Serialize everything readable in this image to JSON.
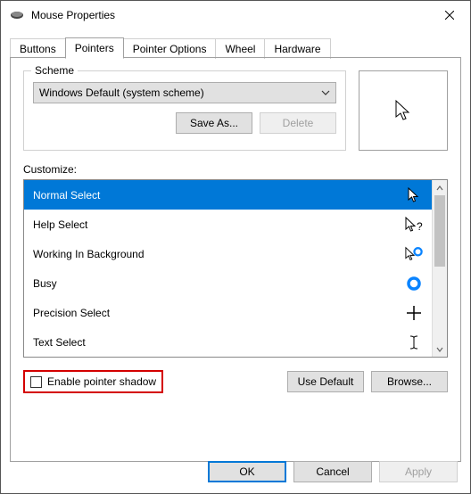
{
  "window": {
    "title": "Mouse Properties"
  },
  "tabs": {
    "items": [
      {
        "label": "Buttons"
      },
      {
        "label": "Pointers"
      },
      {
        "label": "Pointer Options"
      },
      {
        "label": "Wheel"
      },
      {
        "label": "Hardware"
      }
    ],
    "active": 1
  },
  "scheme": {
    "legend": "Scheme",
    "selected": "Windows Default (system scheme)",
    "save_as": "Save As...",
    "delete": "Delete"
  },
  "customize": {
    "label": "Customize:",
    "rows": [
      {
        "label": "Normal Select",
        "icon": "cursor-arrow",
        "selected": true
      },
      {
        "label": "Help Select",
        "icon": "cursor-help"
      },
      {
        "label": "Working In Background",
        "icon": "cursor-working"
      },
      {
        "label": "Busy",
        "icon": "cursor-busy"
      },
      {
        "label": "Precision Select",
        "icon": "cursor-precision"
      },
      {
        "label": "Text Select",
        "icon": "cursor-text"
      }
    ]
  },
  "shadow": {
    "label": "Enable pointer shadow",
    "checked": false
  },
  "actions": {
    "use_default": "Use Default",
    "browse": "Browse..."
  },
  "dialog": {
    "ok": "OK",
    "cancel": "Cancel",
    "apply": "Apply"
  }
}
